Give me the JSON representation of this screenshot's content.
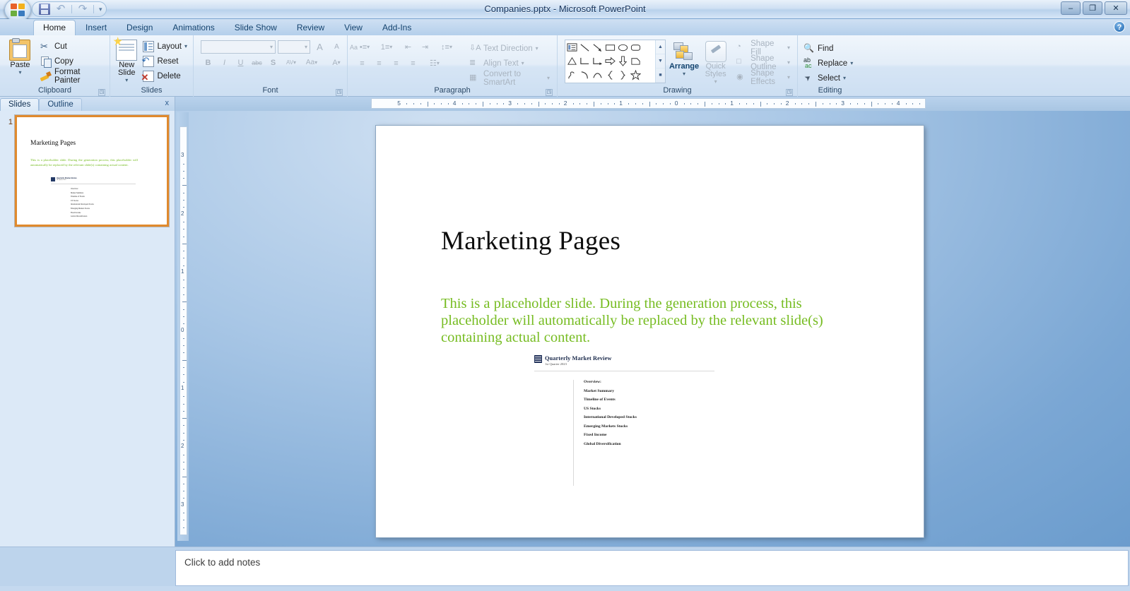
{
  "window": {
    "title": "Companies.pptx - Microsoft PowerPoint",
    "office_button": "office-logo",
    "quick_access": [
      {
        "name": "save",
        "icon": "save-icon"
      },
      {
        "name": "undo",
        "icon": "undo-icon",
        "glyph": "↶"
      },
      {
        "name": "redo",
        "icon": "redo-icon",
        "glyph": "↷"
      },
      {
        "name": "customize",
        "icon": "chevron-down-icon",
        "glyph": "▾"
      }
    ],
    "controls": {
      "minimize": "–",
      "restore": "❐",
      "close": "✕"
    },
    "help": "?"
  },
  "ribbon": {
    "tabs": [
      {
        "label": "Home",
        "active": true
      },
      {
        "label": "Insert",
        "active": false
      },
      {
        "label": "Design",
        "active": false
      },
      {
        "label": "Animations",
        "active": false
      },
      {
        "label": "Slide Show",
        "active": false
      },
      {
        "label": "Review",
        "active": false
      },
      {
        "label": "View",
        "active": false
      },
      {
        "label": "Add-Ins",
        "active": false
      }
    ],
    "groups": {
      "clipboard": {
        "label": "Clipboard",
        "paste": "Paste",
        "items": [
          {
            "label": "Cut",
            "icon": "scissors-icon"
          },
          {
            "label": "Copy",
            "icon": "copy-icon"
          },
          {
            "label": "Format Painter",
            "icon": "format-painter-icon"
          }
        ]
      },
      "slides": {
        "label": "Slides",
        "new_slide": "New Slide",
        "items": [
          {
            "label": "Layout",
            "icon": "layout-icon"
          },
          {
            "label": "Reset",
            "icon": "reset-icon"
          },
          {
            "label": "Delete",
            "icon": "delete-icon"
          }
        ]
      },
      "font": {
        "label": "Font",
        "font_name_value": "",
        "font_size_value": "",
        "grow": "A",
        "shrink": "A",
        "clear_formatting": "Aa",
        "bold": "B",
        "italic": "I",
        "underline": "U",
        "strikethrough": "abc",
        "shadow": "S",
        "spacing": "AV",
        "change_case": "Aa",
        "font_color": "A"
      },
      "paragraph": {
        "label": "Paragraph",
        "text_direction": "Text Direction",
        "align_text": "Align Text",
        "convert_smartart": "Convert to SmartArt"
      },
      "drawing": {
        "label": "Drawing",
        "arrange": "Arrange",
        "quick_styles": "Quick Styles",
        "shape_fill": "Shape Fill",
        "shape_outline": "Shape Outline",
        "shape_effects": "Shape Effects",
        "shapes": [
          "text-box",
          "line",
          "arrow",
          "rectangle",
          "oval",
          "rounded-rectangle",
          "triangle",
          "elbow-connector",
          "elbow-arrow-connector",
          "right-arrow",
          "down-arrow",
          "pentagon-flow",
          "freeform",
          "curve",
          "arc",
          "left-brace",
          "right-brace",
          "star-5"
        ]
      },
      "editing": {
        "label": "Editing",
        "items": [
          {
            "label": "Find",
            "icon": "binoculars-icon"
          },
          {
            "label": "Replace",
            "icon": "replace-icon"
          },
          {
            "label": "Select",
            "icon": "cursor-select-icon"
          }
        ]
      }
    }
  },
  "slide_panel": {
    "tabs": [
      {
        "label": "Slides",
        "active": true
      },
      {
        "label": "Outline",
        "active": false
      }
    ],
    "close": "x",
    "thumbnails": [
      {
        "number": "1",
        "title": "Marketing Pages",
        "body": "This is a placeholder slide. During the generation process, this placeholder will automatically be replaced by the relevant slide(s) containing actual content."
      }
    ]
  },
  "rulers": {
    "horizontal_ticks": [
      "5",
      "4",
      "3",
      "2",
      "1",
      "0",
      "1",
      "2",
      "3",
      "4"
    ],
    "vertical_ticks": [
      "3",
      "2",
      "1",
      "0",
      "1",
      "2",
      "3"
    ]
  },
  "slide": {
    "title": "Marketing Pages",
    "body": "This is a placeholder slide. During the generation process, this placeholder will automatically be replaced by the relevant slide(s) containing actual content.",
    "body_color": "#76bc21",
    "embedded_document": {
      "heading": "Quarterly Market Review",
      "subheading": "1st Quarter 2023",
      "items": [
        "Overview:",
        "Market Summary",
        "Timeline of Events",
        "US Stocks",
        "International Developed Stocks",
        "Emerging Markets Stocks",
        "Fixed Income",
        "Global Diversification"
      ]
    }
  },
  "notes": {
    "placeholder": "Click to add notes"
  }
}
